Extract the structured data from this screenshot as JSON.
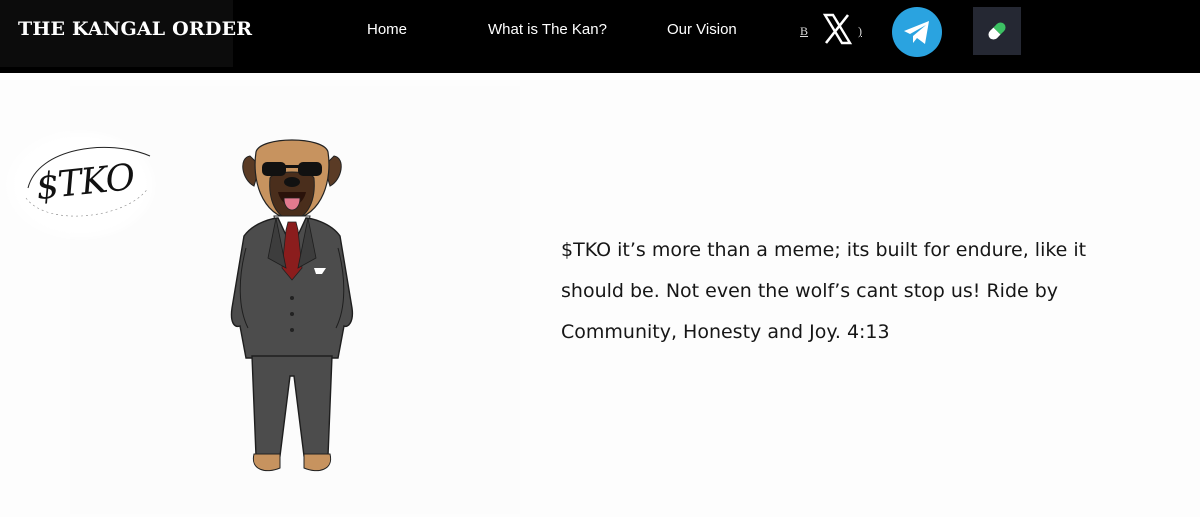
{
  "header": {
    "brand": "THE KANGAL ORDER",
    "nav": [
      {
        "label": "Home"
      },
      {
        "label": "What is The Kan?"
      },
      {
        "label": "Our Vision"
      }
    ],
    "buy_fragment_left": "B",
    "buy_fragment_right": ")",
    "icons": {
      "x": "x-twitter-icon",
      "telegram": "telegram-icon",
      "pill": "pill-icon"
    }
  },
  "hero": {
    "logo_text": "$TKO",
    "tagline": "$TKO it’s more than a meme; its built for endure, like it should be. Not even the wolf’s cant stop us! Ride by Community, Honesty and Joy. 4:13"
  },
  "colors": {
    "nav_bg": "#000000",
    "telegram_blue": "#2aa3e0",
    "pill_btn_bg": "#252833",
    "page_bg": "#fdfdfd"
  }
}
